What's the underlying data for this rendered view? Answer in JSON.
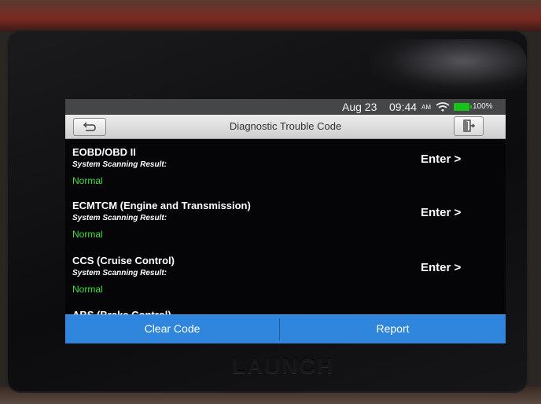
{
  "status_bar": {
    "date": "Aug 23",
    "time": "09:44",
    "ampm": "AM",
    "battery": "100%",
    "battery_color": "#19c219",
    "wifi_icon": "wifi-icon",
    "battery_icon": "battery-icon"
  },
  "title_bar": {
    "title": "Diagnostic Trouble Code",
    "back_icon": "back-icon",
    "exit_icon": "exit-icon"
  },
  "systems": [
    {
      "name": "EOBD/OBD II",
      "result_label": "System Scanning Result:",
      "status": "Normal",
      "action": "Enter >"
    },
    {
      "name": "ECMTCM (Engine and Transmission)",
      "result_label": "System Scanning Result:",
      "status": "Normal",
      "action": "Enter >"
    },
    {
      "name": "CCS (Cruise Control)",
      "result_label": "System Scanning Result:",
      "status": "Normal",
      "action": "Enter >"
    },
    {
      "name": "ABS (Brake Control)",
      "result_label": "",
      "status": "",
      "action": ""
    }
  ],
  "bottom_bar": {
    "clear_code": "Clear Code",
    "report": "Report"
  },
  "brand": "LAUNCH",
  "colors": {
    "status_normal": "#3ee03e",
    "action_bar": "#2f86dc",
    "screen_bg": "#050507"
  }
}
